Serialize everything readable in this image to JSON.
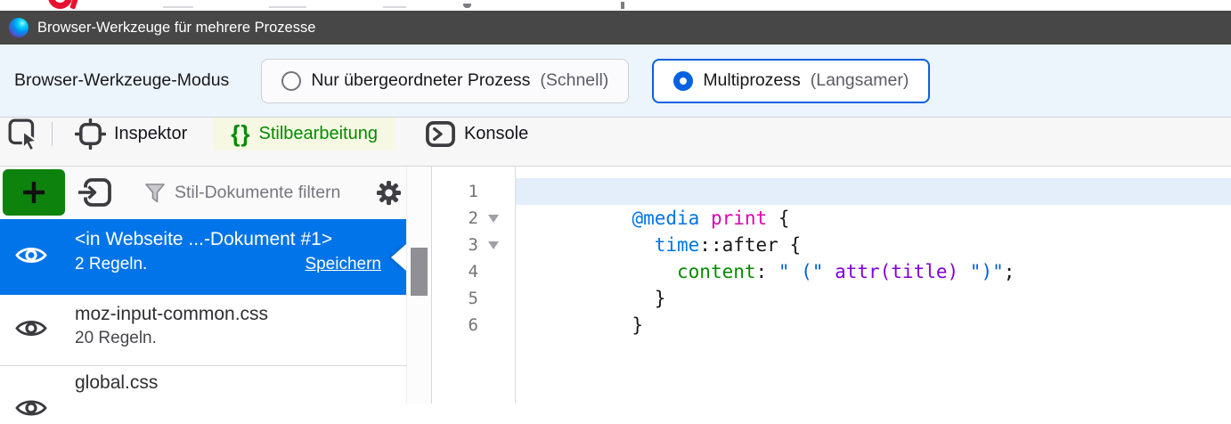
{
  "window": {
    "title": "Browser-Werkzeuge für mehrere Prozesse"
  },
  "mode": {
    "label": "Browser-Werkzeuge-Modus",
    "options": [
      {
        "label": "Nur übergeordneter Prozess",
        "hint": "(Schnell)",
        "selected": false
      },
      {
        "label": "Multiprozess",
        "hint": "(Langsamer)",
        "selected": true
      }
    ]
  },
  "tabs": [
    {
      "label": "Inspektor",
      "active": false
    },
    {
      "label": "Stilbearbeitung",
      "active": true,
      "icon_glyph": "{}"
    },
    {
      "label": "Konsole",
      "active": false
    }
  ],
  "styleeditor": {
    "filter_placeholder": "Stil-Dokumente filtern",
    "sheets": [
      {
        "title": "<in Webseite ...-Dokument #1>",
        "rules": "2 Regeln.",
        "action": "Speichern",
        "selected": true
      },
      {
        "title": "moz-input-common.css",
        "rules": "20 Regeln.",
        "selected": false
      },
      {
        "title": "global.css",
        "selected": false
      }
    ]
  },
  "editor": {
    "lines": [
      {
        "num": "1",
        "fold": false,
        "active": true,
        "tokens": []
      },
      {
        "num": "2",
        "fold": true,
        "active": false,
        "tokens": [
          {
            "c": "plain",
            "t": "          "
          },
          {
            "c": "def",
            "t": "@media"
          },
          {
            "c": "plain",
            "t": " "
          },
          {
            "c": "keyword",
            "t": "print"
          },
          {
            "c": "plain",
            "t": " {"
          }
        ]
      },
      {
        "num": "3",
        "fold": true,
        "active": false,
        "tokens": [
          {
            "c": "plain",
            "t": "            "
          },
          {
            "c": "tag",
            "t": "time"
          },
          {
            "c": "plain",
            "t": "::after {"
          }
        ]
      },
      {
        "num": "4",
        "fold": false,
        "active": false,
        "tokens": [
          {
            "c": "plain",
            "t": "              "
          },
          {
            "c": "property",
            "t": "content"
          },
          {
            "c": "plain",
            "t": ": "
          },
          {
            "c": "string",
            "t": "\" (\""
          },
          {
            "c": "plain",
            "t": " "
          },
          {
            "c": "func",
            "t": "attr(title)"
          },
          {
            "c": "plain",
            "t": " "
          },
          {
            "c": "string",
            "t": "\")\""
          },
          {
            "c": "plain",
            "t": ";"
          }
        ]
      },
      {
        "num": "5",
        "fold": false,
        "active": false,
        "tokens": [
          {
            "c": "plain",
            "t": "            }"
          }
        ]
      },
      {
        "num": "6",
        "fold": false,
        "active": false,
        "tokens": [
          {
            "c": "plain",
            "t": "          }"
          }
        ]
      }
    ]
  },
  "colors": {
    "titlebar_bg": "#474747",
    "mode_row_bg": "#ecf4fc",
    "accent_blue": "#0562e0",
    "selection_blue": "#0074e8",
    "active_tab_bg": "#f6f8e4",
    "active_tab_green": "#058b00",
    "add_button_green": "#0d830d",
    "active_line_bg": "#e4eefb",
    "syntax": {
      "at_rule": "#0074e8",
      "keyword": "#dd00a9",
      "selector": "#0074e8",
      "property": "#058b00",
      "string": "#0060df",
      "function": "#8000d7"
    }
  }
}
